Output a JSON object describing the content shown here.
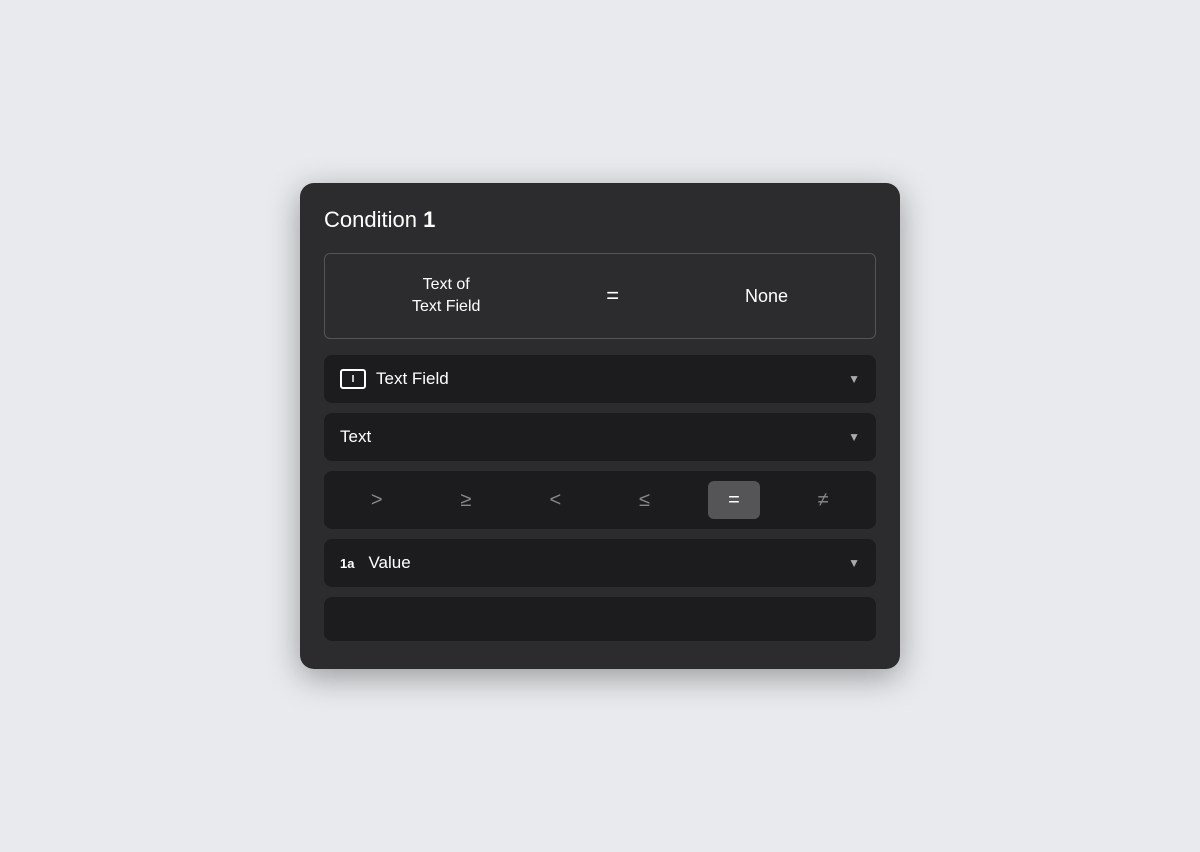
{
  "card": {
    "title_prefix": "Condition ",
    "title_number": "1"
  },
  "preview": {
    "label_line1": "Text of",
    "label_line2": "Text Field",
    "operator": "=",
    "value": "None"
  },
  "field_dropdown": {
    "label": "Text Field",
    "icon": "I"
  },
  "type_dropdown": {
    "label": "Text"
  },
  "operators": [
    {
      "symbol": ">",
      "active": false,
      "name": "greater-than"
    },
    {
      "symbol": "≥",
      "active": false,
      "name": "greater-than-or-equal"
    },
    {
      "symbol": "<",
      "active": false,
      "name": "less-than"
    },
    {
      "symbol": "≤",
      "active": false,
      "name": "less-than-or-equal"
    },
    {
      "symbol": "=",
      "active": true,
      "name": "equal"
    },
    {
      "symbol": "≠",
      "active": false,
      "name": "not-equal"
    }
  ],
  "value_dropdown": {
    "prefix": "1a",
    "label": "Value"
  },
  "colors": {
    "background": "#e8eaed",
    "card": "#2c2c2e",
    "row": "#1c1c1e",
    "active_op": "#555558",
    "text": "#ffffff",
    "muted": "#888888"
  }
}
